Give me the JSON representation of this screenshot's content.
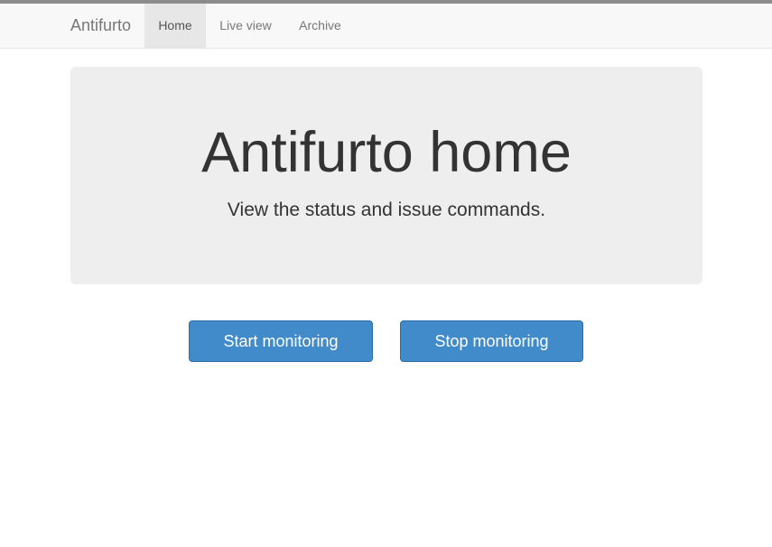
{
  "navbar": {
    "brand": "Antifurto",
    "items": [
      {
        "label": "Home",
        "active": true
      },
      {
        "label": "Live view",
        "active": false
      },
      {
        "label": "Archive",
        "active": false
      }
    ]
  },
  "jumbotron": {
    "title": "Antifurto home",
    "subtitle": "View the status and issue commands."
  },
  "actions": {
    "start_label": "Start monitoring",
    "stop_label": "Stop monitoring"
  },
  "colors": {
    "primary_button": "#428bca",
    "navbar_bg": "#f8f8f8",
    "jumbotron_bg": "#eeeeee"
  }
}
